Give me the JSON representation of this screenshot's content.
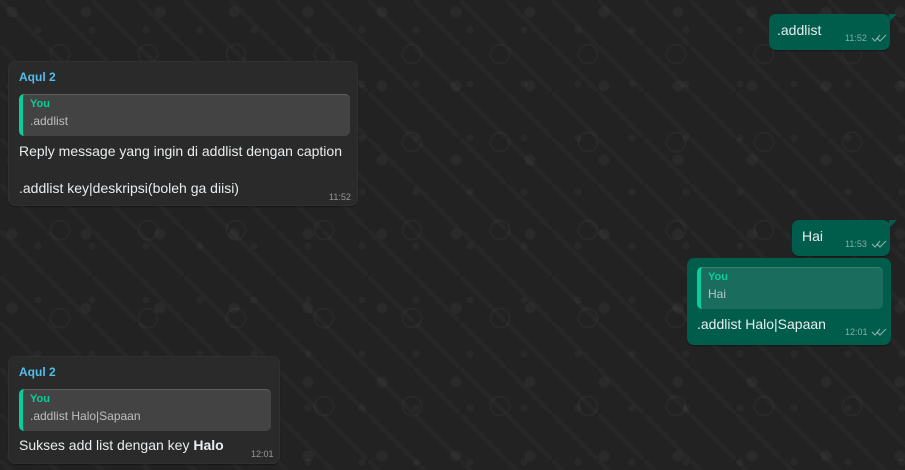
{
  "chat": {
    "messages": [
      {
        "direction": "outgoing",
        "text": ".addlist",
        "time": "11:52",
        "status_icon": "double-check-icon"
      },
      {
        "direction": "incoming",
        "sender": "Aqul 2",
        "quote": {
          "author": "You",
          "text": ".addlist"
        },
        "lines": [
          "Reply message yang ingin di addlist dengan caption",
          ".addlist key|deskripsi(boleh ga diisi)"
        ],
        "time": "11:52"
      },
      {
        "direction": "outgoing",
        "text": "Hai",
        "time": "11:53",
        "status_icon": "double-check-icon"
      },
      {
        "direction": "outgoing",
        "quote": {
          "author": "You",
          "text": "Hai"
        },
        "text": ".addlist Halo|Sapaan",
        "time": "12:01",
        "status_icon": "double-check-icon"
      },
      {
        "direction": "incoming",
        "sender": "Aqul 2",
        "quote": {
          "author": "You",
          "text": ".addlist Halo|Sapaan"
        },
        "text_prefix": "Sukses add list dengan key",
        "text_bold": "Halo",
        "time": "12:01"
      }
    ]
  },
  "colors": {
    "background": "#222222",
    "incoming_bubble": "#2a2a2a",
    "outgoing_bubble": "#005c4b",
    "sender_name": "#53bdeb",
    "quote_accent": "#06cf9c"
  }
}
